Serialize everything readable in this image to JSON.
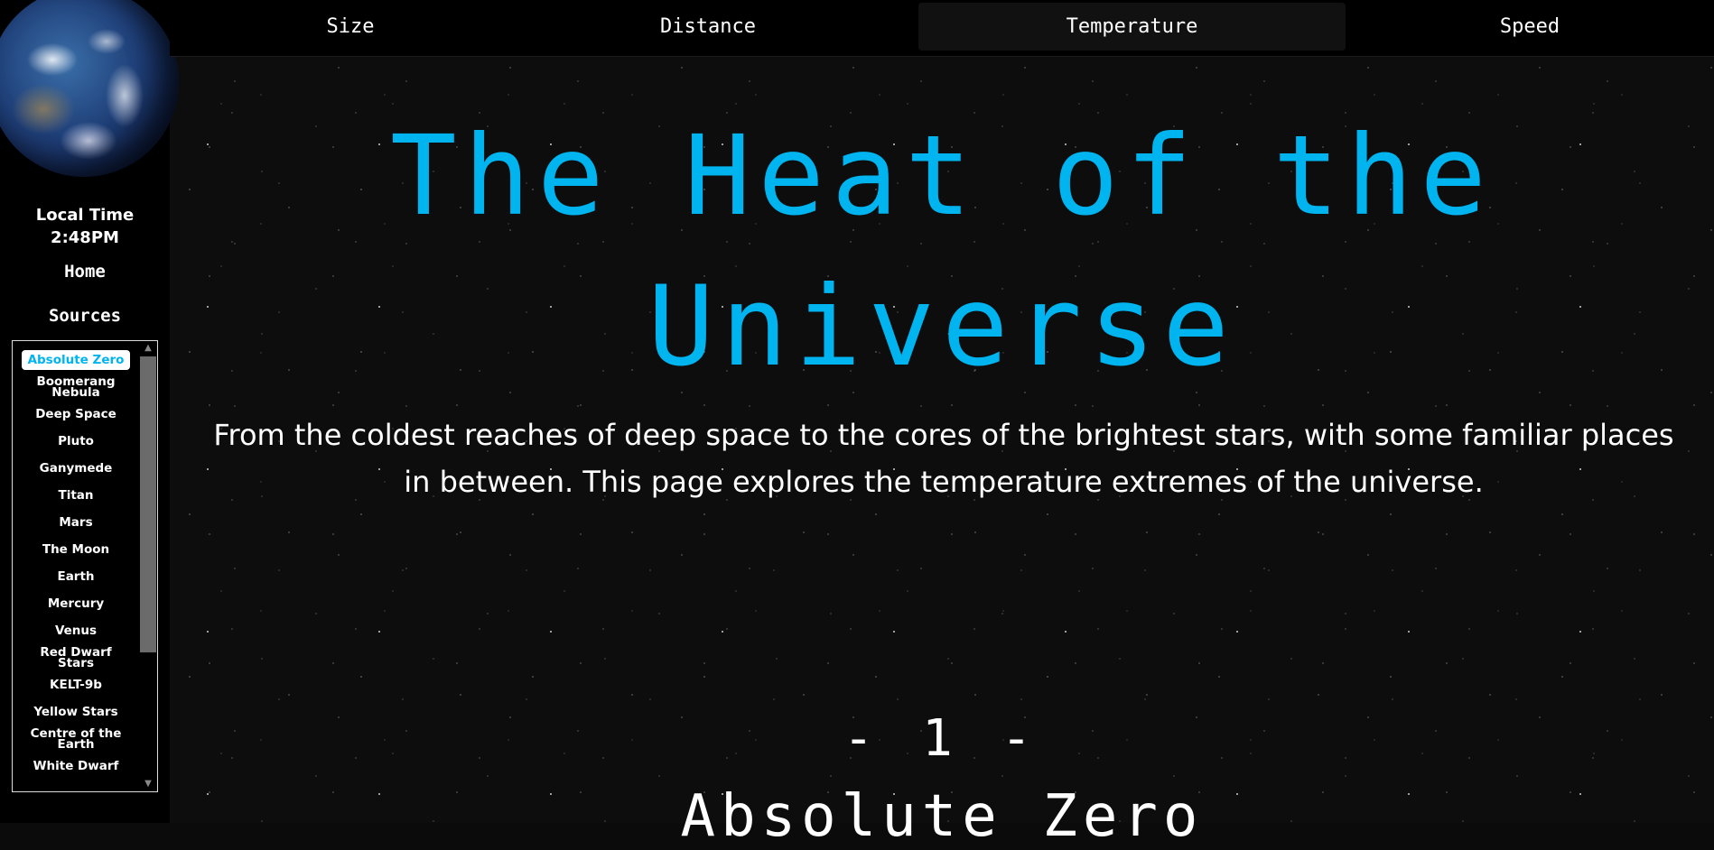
{
  "sidebar": {
    "local_time_label": "Local Time",
    "local_time_value": "2:48PM",
    "home_label": "Home",
    "sources_label": "Sources",
    "items": [
      {
        "label": "Absolute Zero",
        "active": true
      },
      {
        "label": "Boomerang Nebula"
      },
      {
        "label": "Deep Space"
      },
      {
        "label": "Pluto"
      },
      {
        "label": "Ganymede"
      },
      {
        "label": "Titan"
      },
      {
        "label": "Mars"
      },
      {
        "label": "The Moon"
      },
      {
        "label": "Earth"
      },
      {
        "label": "Mercury"
      },
      {
        "label": "Venus"
      },
      {
        "label": "Red Dwarf Stars"
      },
      {
        "label": "KELT-9b"
      },
      {
        "label": "Yellow Stars"
      },
      {
        "label": "Centre of the Earth"
      },
      {
        "label": "White Dwarf"
      }
    ],
    "scroll_up_icon": "▲",
    "scroll_down_icon": "▼"
  },
  "nav": {
    "tabs": [
      {
        "label": "Size"
      },
      {
        "label": "Distance"
      },
      {
        "label": "Temperature",
        "active": true
      },
      {
        "label": "Speed"
      }
    ]
  },
  "main": {
    "title_line1": "The Heat of the",
    "title_line2": "Universe",
    "intro": "From the coldest reaches of deep space to the cores of the brightest stars, with some familiar places in between. This page explores the temperature extremes of the universe.",
    "section_number": "- 1 -",
    "section_title": "Absolute Zero"
  },
  "colors": {
    "accent": "#00b4ef",
    "background": "#0d0d0d",
    "text": "#ffffff"
  }
}
